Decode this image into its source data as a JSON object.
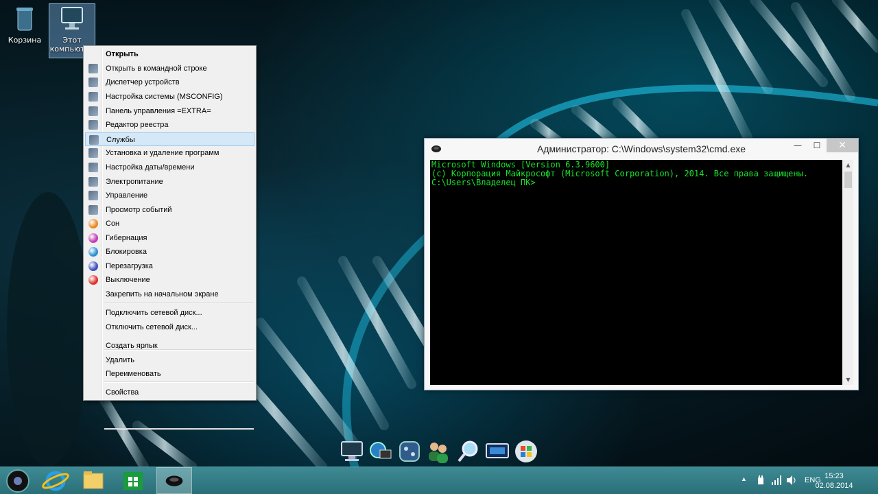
{
  "desktop": {
    "icons": [
      {
        "label": "Корзина",
        "icon": "recycle-bin-icon"
      },
      {
        "label": "Этот компьютер",
        "icon": "computer-icon"
      }
    ]
  },
  "context_menu": {
    "items": [
      {
        "label": "Открыть",
        "icon": "",
        "bold": true
      },
      {
        "label": "Открыть в командной строке",
        "icon": "console-icon"
      },
      {
        "label": "Диспетчер устройств",
        "icon": "device-manager-icon"
      },
      {
        "label": "Настройка системы (MSCONFIG)",
        "icon": "msconfig-icon"
      },
      {
        "label": "Панель управления =EXTRA=",
        "icon": "control-panel-icon"
      },
      {
        "label": "Редактор реестра",
        "icon": "registry-icon"
      },
      {
        "label": "Службы",
        "icon": "services-icon",
        "highlighted": true
      },
      {
        "label": "Установка и удаление программ",
        "icon": "programs-icon"
      },
      {
        "label": "Настройка даты/времени",
        "icon": "datetime-icon"
      },
      {
        "label": "Электропитание",
        "icon": "power-options-icon"
      },
      {
        "label": "Управление",
        "icon": "management-icon"
      },
      {
        "label": "Просмотр событий",
        "icon": "event-viewer-icon"
      },
      {
        "label": "Сон",
        "icon": "sleep-icon",
        "color": "#e88a1e"
      },
      {
        "label": "Гибернация",
        "icon": "hibernate-icon",
        "color": "#c23bb0"
      },
      {
        "label": "Блокировка",
        "icon": "lock-icon",
        "color": "#2a8fd0"
      },
      {
        "label": "Перезагрузка",
        "icon": "restart-icon",
        "color": "#3b4fb8"
      },
      {
        "label": "Выключение",
        "icon": "shutdown-icon",
        "color": "#e0302a"
      },
      {
        "label": "Закрепить на начальном экране",
        "icon": ""
      },
      {
        "label": "Подключить сетевой диск...",
        "icon": ""
      },
      {
        "label": "Отключить сетевой диск...",
        "icon": ""
      },
      {
        "label": "Создать ярлык",
        "icon": ""
      },
      {
        "label": "Удалить",
        "icon": ""
      },
      {
        "label": "Переименовать",
        "icon": ""
      },
      {
        "label": "Свойства",
        "icon": ""
      }
    ]
  },
  "cmd_window": {
    "title": "Администратор: C:\\Windows\\system32\\cmd.exe",
    "minimize": "—",
    "maximize": "☐",
    "close": "✕",
    "lines": [
      "Microsoft Windows [Version 6.3.9600]",
      "(c) Корпорация Майкрософт (Microsoft Corporation), 2014. Все права защищены.",
      "",
      "C:\\Users\\Владелец ПК>"
    ],
    "text_color": "#19e62c"
  },
  "dock": {
    "items": [
      "monitor-icon",
      "network-icon",
      "control-panel-icon",
      "users-icon",
      "search-icon",
      "display-icon",
      "windows-icon"
    ]
  },
  "taskbar": {
    "buttons": [
      "start-icon",
      "internet-explorer-icon",
      "file-explorer-icon",
      "store-icon",
      "console-icon"
    ],
    "language": "ENG",
    "time": "15:23",
    "date": "02.08.2014"
  }
}
